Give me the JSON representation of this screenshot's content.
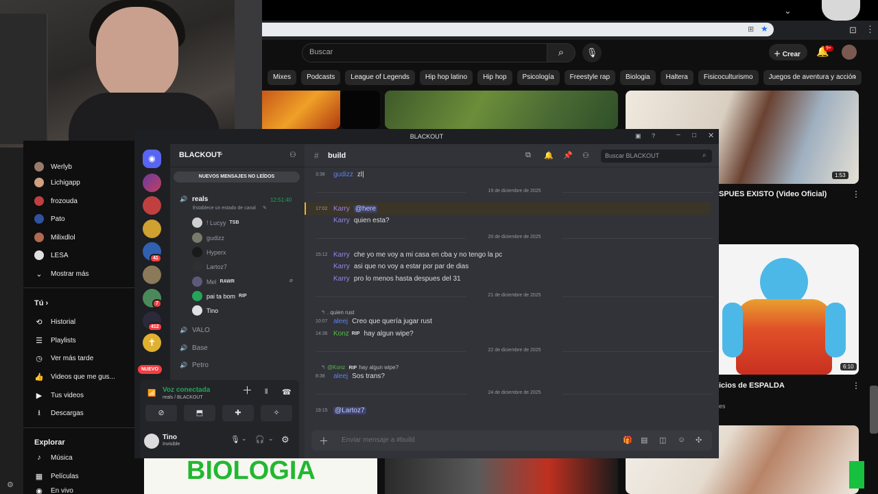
{
  "colors": {
    "youtube_bg": "#0f0f0f",
    "discord_bg": "#313338",
    "discord_accent": "#5865f2",
    "voice_green": "#23a55a",
    "mention_bg": "#3c4270",
    "badge_red": "#f23f43"
  },
  "youtube": {
    "search_placeholder": "Buscar",
    "create_label": "Crear",
    "notif_count": "9+",
    "chips": [
      "Mixes",
      "Podcasts",
      "League of Legends",
      "Hip hop latino",
      "Hip hop",
      "Psicología",
      "Freestyle rap",
      "Biologia",
      "Haltera",
      "Fisicoculturismo",
      "Juegos de aventura y acción"
    ],
    "videos": [
      {
        "title": "SPUES EXISTO (Video Oficial)",
        "duration": "1:53"
      },
      {
        "title": "icios de ESPALDA",
        "duration": "6:10",
        "meta": "es"
      }
    ],
    "thumb_text": "BIOLOGIA",
    "sidebar": {
      "subscriptions": [
        {
          "name": "Werlyb",
          "dot": ""
        },
        {
          "name": "Lichigapp",
          "dot": ""
        },
        {
          "name": "frozouda",
          "dot": "•"
        },
        {
          "name": "Pato",
          "dot": "•"
        },
        {
          "name": "Milixdlol",
          "dot": "•"
        },
        {
          "name": "LESA",
          "dot": ""
        }
      ],
      "show_more": "Mostrar más",
      "you_header": "Tú",
      "you_items": [
        "Historial",
        "Playlists",
        "Ver más tarde",
        "Videos que me gus...",
        "Tus videos",
        "Descargas"
      ],
      "explore_header": "Explorar",
      "explore_items": [
        "Música",
        "Películas",
        "En vivo"
      ]
    }
  },
  "discord": {
    "window_title": "BLACKOUT",
    "server_name": "BLACKOUT",
    "unread_banner": "NUEVOS MENSAJES NO LEÍDOS",
    "new_label": "NUEVO",
    "guild_badges": [
      "41",
      "7",
      "412"
    ],
    "voice_channel": {
      "name": "reals",
      "timer": "12:51:40",
      "status": "Establece un estado de canal"
    },
    "voice_users": [
      {
        "name": "! Lucyy",
        "tag": "TSB"
      },
      {
        "name": "gudizz",
        "tag": ""
      },
      {
        "name": "Hyperx",
        "tag": ""
      },
      {
        "name": "Lartoz7",
        "tag": ""
      },
      {
        "name": "Mel",
        "tag": "RAWR"
      },
      {
        "name": "pai ta bom",
        "tag": "RIP"
      },
      {
        "name": "Tino",
        "tag": ""
      }
    ],
    "other_channels": [
      "VALO",
      "Base",
      "Petro"
    ],
    "channel_header": "build",
    "search_placeholder": "Buscar BLACKOUT",
    "voice_status": "Voz conectada",
    "voice_sub": "reals / BLACKOUT",
    "user": {
      "name": "Tino",
      "status": "Invisible"
    },
    "composer_placeholder": "Enviar mensaje a #build",
    "messages": {
      "m0": {
        "time": "3:38",
        "author": "gudizz",
        "text": "zl|"
      },
      "d1": "19 de diciembre de 2025",
      "m1": {
        "time": "17:02",
        "author": "Karry",
        "text": "@here"
      },
      "m2": {
        "author": "Karry",
        "text": "quien esta?"
      },
      "d2": "20 de diciembre de 2025",
      "m3": {
        "time": "15:12",
        "author": "Karry",
        "text": "che yo me voy a mi casa en cba y no tengo la pc"
      },
      "m4": {
        "author": "Karry",
        "text": "asi que no voy a estar por par de dias"
      },
      "m5": {
        "author": "Karry",
        "text": "pro lo menos hasta despues del 31"
      },
      "d3": "21 de diciembre de 2025",
      "r1": ". quien rust",
      "m6": {
        "time": "10:07",
        "author": "aleej",
        "text": "Creo que quería jugar rust"
      },
      "m7": {
        "time": "14:36",
        "author": "Konz",
        "tag": "RIP",
        "text": "hay algun wipe?"
      },
      "d4": "22 de diciembre de 2025",
      "r2_author": "@Konz",
      "r2_tag": "RIP",
      "r2_text": "hay algun wipe?",
      "m8": {
        "time": "8:38",
        "author": "aleej",
        "text": "Sos trans?"
      },
      "d5": "24 de diciembre de 2025",
      "m9": {
        "time": "19:15",
        "text": "@Lartoz7"
      }
    }
  }
}
